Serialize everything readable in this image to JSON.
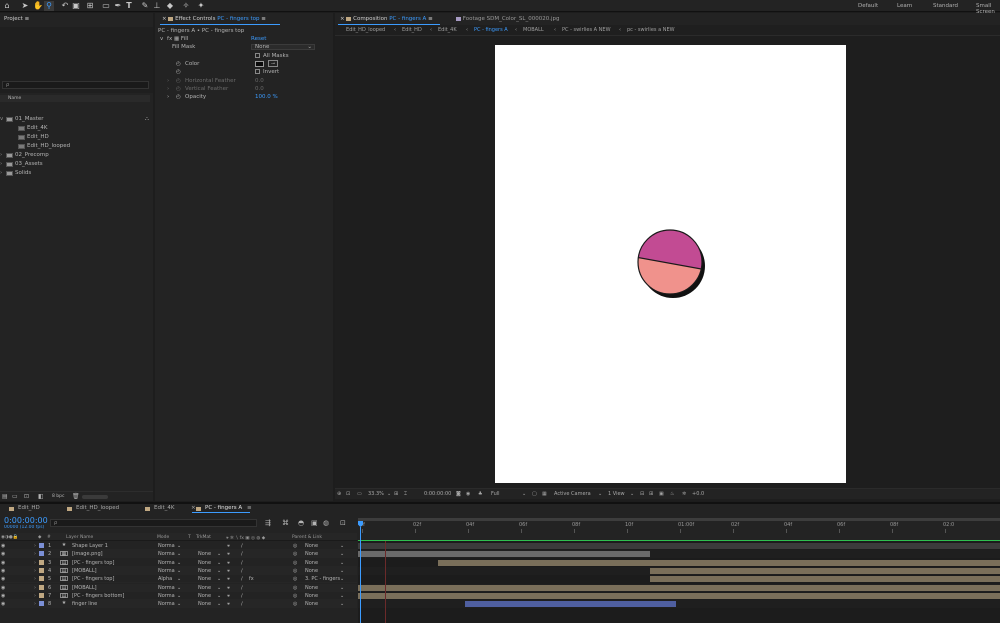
{
  "workspaces": [
    "Default",
    "Learn",
    "Standard",
    "Small Screen"
  ],
  "project": {
    "title": "Project",
    "search_placeholder": "ρ",
    "column_name": "Name",
    "items": [
      {
        "label": "01_Master",
        "type": "folder",
        "open": true
      },
      {
        "label": "Edit_4K",
        "type": "comp",
        "indent": 1
      },
      {
        "label": "Edit_HD",
        "type": "comp",
        "indent": 1
      },
      {
        "label": "Edit_HD_looped",
        "type": "comp",
        "indent": 1
      },
      {
        "label": "02_Precomp",
        "type": "folder"
      },
      {
        "label": "03_Assets",
        "type": "folder"
      },
      {
        "label": "Solids",
        "type": "folder"
      }
    ],
    "bpc": "8 bpc"
  },
  "effect_controls": {
    "tab_prefix": "Effect Controls",
    "tab_layer": "PC - fingers top",
    "breadcrumb": "PC - fingers A • PC - fingers top",
    "effect_name": "Fill",
    "reset_label": "Reset",
    "fill_mask_label": "Fill Mask",
    "fill_mask_value": "None",
    "all_masks_label": "All Masks",
    "color_label": "Color",
    "invert_label": "Invert",
    "horizontal_feather_label": "Horizontal Feather",
    "horizontal_feather_value": "0.0",
    "vertical_feather_label": "Vertical Feather",
    "vertical_feather_value": "0.0",
    "opacity_label": "Opacity",
    "opacity_value": "100.0 %"
  },
  "composition": {
    "tab_prefix": "Composition",
    "tab_name": "PC - fingers A",
    "footage_tab": "Footage  SDM_Color_SL_000020.jpg",
    "breadcrumbs": [
      "Edit_HD_looped",
      "Edit_HD",
      "Edit_4K",
      "PC - fingers A",
      "MOBALL",
      "PC - swirlies A NEW",
      "pc - swirlies a NEW"
    ],
    "active_crumb": 3
  },
  "viewer": {
    "zoom": "33.3%",
    "timecode": "0:00:00:00",
    "resolution": "Full",
    "camera": "Active Camera",
    "views": "1 View",
    "exposure": "+0.0"
  },
  "timeline": {
    "tabs": [
      "Edit_HD",
      "Edit_HD_looped",
      "Edit_4K",
      "PC - fingers A"
    ],
    "active_tab": 3,
    "timecode": "0:00:00:00",
    "fps_info": "00000 (12.00 fps)",
    "search_placeholder": "ρ",
    "columns": {
      "number": "#",
      "layer_name": "Layer Name",
      "mode": "Mode",
      "track": "T",
      "trkmat": "TrkMat",
      "parent": "Parent & Link"
    },
    "ruler": [
      "0f",
      "02f",
      "04f",
      "06f",
      "08f",
      "10f",
      "01:00f",
      "02f",
      "04f",
      "06f",
      "08f",
      "02:0"
    ],
    "layers": [
      {
        "num": "1",
        "name": "Shape Layer 1",
        "mode": "Norma",
        "trkmat": "",
        "parent": "None",
        "color": "#7b8fd6",
        "icon": "star",
        "bar_start": 0.0,
        "bar_end": 1.0
      },
      {
        "num": "2",
        "name": "[image.png]",
        "mode": "Norma",
        "trkmat": "None",
        "parent": "None",
        "color": "#7b8fd6",
        "icon": "image",
        "bar_start": 0.0,
        "bar_end": 0.455
      },
      {
        "num": "3",
        "name": "[PC - fingers top]",
        "mode": "Norma",
        "trkmat": "None",
        "parent": "None",
        "color": "#c0a882",
        "icon": "comp",
        "bar_start": 0.124,
        "bar_end": 1.0
      },
      {
        "num": "4",
        "name": "[MOBALL]",
        "mode": "Norma",
        "trkmat": "None",
        "parent": "None",
        "color": "#c0a882",
        "icon": "comp",
        "bar_start": 0.455,
        "bar_end": 1.0
      },
      {
        "num": "5",
        "name": "[PC - fingers top]",
        "mode": "Alpha",
        "trkmat": "None",
        "parent": "3. PC - fingers",
        "color": "#c0a882",
        "icon": "comp",
        "bar_start": 0.455,
        "bar_end": 1.0
      },
      {
        "num": "6",
        "name": "[MOBALL]",
        "mode": "Norma",
        "trkmat": "None",
        "parent": "None",
        "color": "#c0a882",
        "icon": "comp",
        "bar_start": 0.0,
        "bar_end": 1.0
      },
      {
        "num": "7",
        "name": "[PC - fingers bottom]",
        "mode": "Norma",
        "trkmat": "None",
        "parent": "None",
        "color": "#c0a882",
        "icon": "comp",
        "bar_start": 0.0,
        "bar_end": 1.0
      },
      {
        "num": "8",
        "name": "finger line",
        "mode": "Norma",
        "trkmat": "None",
        "parent": "None",
        "color": "#7b8fd6",
        "icon": "star",
        "bar_start": 0.166,
        "bar_end": 0.495
      }
    ]
  }
}
